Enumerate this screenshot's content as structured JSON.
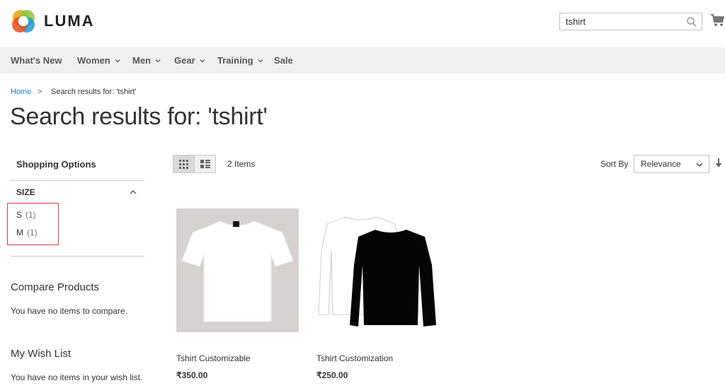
{
  "header": {
    "brand": "LUMA",
    "search_value": "tshirt"
  },
  "nav": {
    "items": [
      {
        "label": "What's New",
        "has_dropdown": false
      },
      {
        "label": "Women",
        "has_dropdown": true
      },
      {
        "label": "Men",
        "has_dropdown": true
      },
      {
        "label": "Gear",
        "has_dropdown": true
      },
      {
        "label": "Training",
        "has_dropdown": true
      },
      {
        "label": "Sale",
        "has_dropdown": false
      }
    ]
  },
  "breadcrumb": {
    "home": "Home",
    "separator": ">",
    "current": "Search results for: 'tshirt'"
  },
  "page_title": "Search results for: 'tshirt'",
  "sidebar": {
    "shopping_options": "Shopping Options",
    "size_filter": {
      "title": "SIZE",
      "options": [
        {
          "label": "S",
          "count": "(1)"
        },
        {
          "label": "M",
          "count": "(1)"
        }
      ]
    },
    "compare": {
      "title": "Compare Products",
      "empty_text": "You have no items to compare."
    },
    "wishlist": {
      "title": "My Wish List",
      "empty_text": "You have no items in your wish list."
    }
  },
  "toolbar": {
    "item_count": "2 Items",
    "sort_label": "Sort By",
    "sort_value": "Relevance"
  },
  "products": [
    {
      "name": "Tshirt Customizable",
      "price": "₹350.00"
    },
    {
      "name": "Tshirt Customization",
      "price": "₹250.00"
    }
  ],
  "colors": {
    "accent_link": "#1979c3",
    "nav_bg": "#f0f0f0",
    "highlight_border": "#e03a3a"
  }
}
